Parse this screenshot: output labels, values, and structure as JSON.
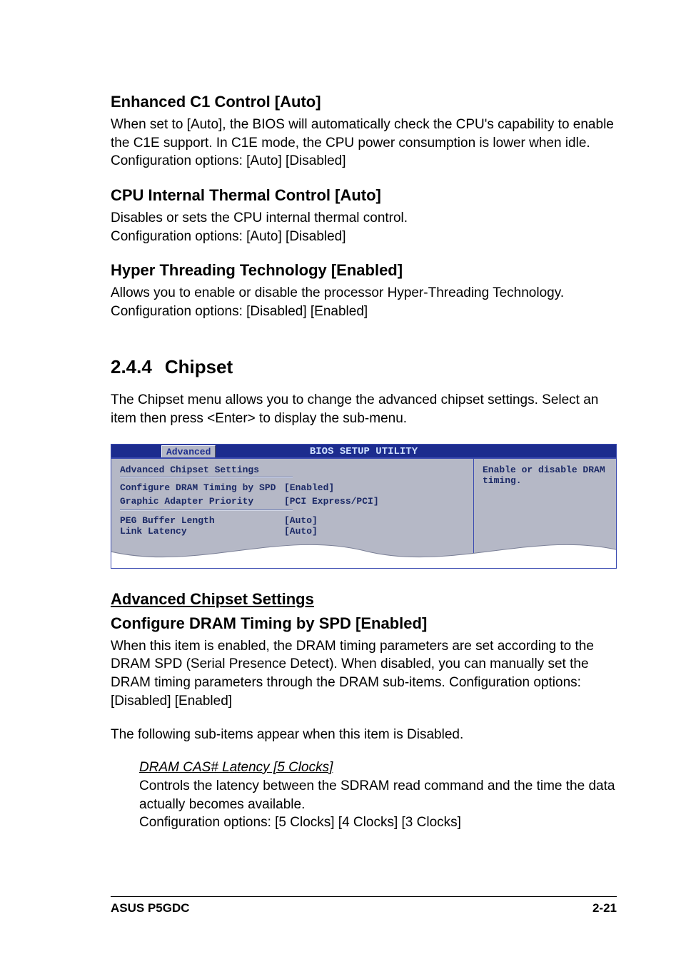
{
  "sections": {
    "enhanced_c1": {
      "heading": "Enhanced C1 Control [Auto]",
      "body": "When set to [Auto], the BIOS will automatically check the CPU's capability to enable the C1E support. In C1E mode, the CPU power consumption is lower when idle. Configuration options: [Auto] [Disabled]"
    },
    "cpu_thermal": {
      "heading": "CPU Internal Thermal Control [Auto]",
      "body": "Disables or sets the CPU internal thermal control.\nConfiguration options: [Auto] [Disabled]"
    },
    "hyper_threading": {
      "heading": "Hyper Threading Technology [Enabled]",
      "body": "Allows you to enable or disable the processor Hyper-Threading Technology. Configuration options: [Disabled] [Enabled]"
    }
  },
  "chapter": {
    "number": "2.4.4",
    "title": "Chipset",
    "intro": "The Chipset menu allows you to change the advanced chipset settings. Select an item then press <Enter> to display the sub-menu."
  },
  "bios": {
    "title": "BIOS SETUP UTILITY",
    "tab": "Advanced",
    "left_heading": "Advanced Chipset Settings",
    "rows": [
      {
        "label": "Configure DRAM Timing by SPD",
        "value": "[Enabled]"
      },
      {
        "label": "Graphic Adapter Priority",
        "value": "[PCI Express/PCI]"
      }
    ],
    "rows2": [
      {
        "label": "PEG Buffer Length",
        "value": "[Auto]"
      },
      {
        "label": "Link Latency",
        "value": "[Auto]"
      }
    ],
    "help": "Enable or disable DRAM timing."
  },
  "advanced_chipset": {
    "heading": "Advanced Chipset Settings"
  },
  "configure_dram": {
    "heading": "Configure DRAM Timing by SPD [Enabled]",
    "body": "When this item is enabled, the DRAM timing parameters are set according to the DRAM SPD (Serial Presence Detect). When disabled, you can manually set the DRAM timing parameters through the DRAM sub-items. Configuration options: [Disabled] [Enabled]",
    "note": "The following sub-items appear when this item is Disabled."
  },
  "dram_cas": {
    "heading": "DRAM CAS# Latency [5 Clocks]",
    "body": "Controls the latency between the SDRAM read command and the time the data actually becomes available.\nConfiguration options: [5 Clocks] [4 Clocks] [3 Clocks]"
  },
  "footer": {
    "left": "ASUS P5GDC",
    "right": "2-21"
  }
}
